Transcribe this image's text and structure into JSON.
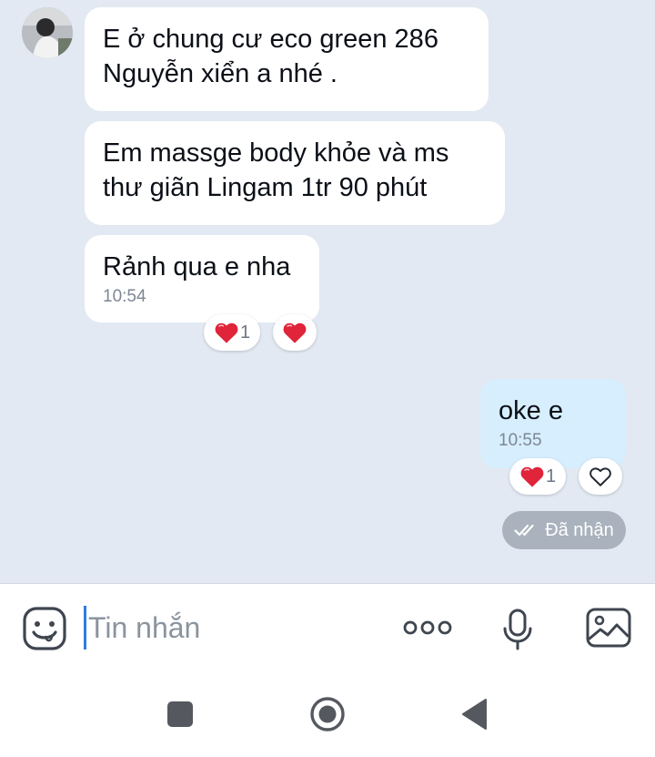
{
  "messages": [
    {
      "lines": [
        "E ở chung cư eco green 286",
        "Nguyễn xiển a nhé ."
      ]
    },
    {
      "lines": [
        "Em massge body khỏe và ms",
        "thư giãn Lingam 1tr 90 phút"
      ]
    },
    {
      "lines": [
        "Rảnh qua e nha"
      ],
      "time": "10:54",
      "reactions": [
        {
          "icon": "heart-icon",
          "count": "1"
        },
        {
          "icon": "heart-icon"
        }
      ]
    },
    {
      "lines": [
        "oke e"
      ],
      "time": "10:55",
      "reactions": [
        {
          "icon": "heart-icon",
          "count": "1"
        },
        {
          "icon": "heart-outline-icon"
        }
      ]
    }
  ],
  "status": {
    "label": "Đã nhận",
    "icon": "double-check-icon"
  },
  "composer": {
    "placeholder": "Tin nhắn",
    "icons": [
      "emoji-icon",
      "more-icon",
      "microphone-icon",
      "image-icon"
    ]
  },
  "colors": {
    "chat_background": "#e2e9f2",
    "incoming_bubble": "#ffffff",
    "outgoing_bubble": "#d6eefe",
    "heart": "#e0243a",
    "status_pill": "#a9b2bd",
    "caret": "#2a7de1"
  }
}
